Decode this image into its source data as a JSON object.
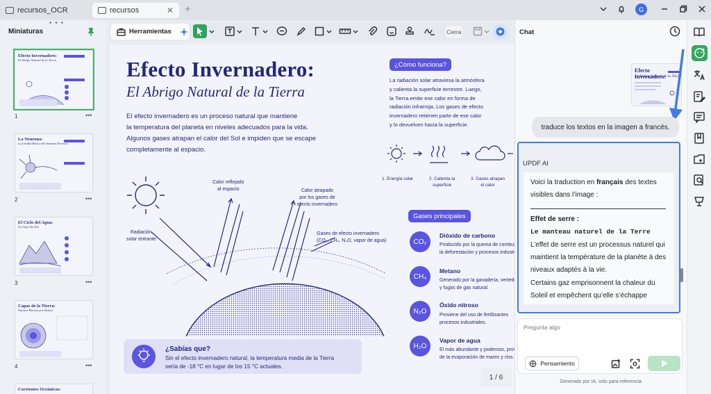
{
  "tabs": [
    {
      "label": "recursos_OCR"
    },
    {
      "label": "recursos"
    }
  ],
  "left_panel": {
    "title": "Miniaturas",
    "pages": [
      {
        "num": "1",
        "t1": "Efecto Invernadero:",
        "t2": "El Abrigo Natural de la Tierra"
      },
      {
        "num": "2",
        "t1": "La Neurona:",
        "t2": "La Unidad Básica del Sistema Nervioso"
      },
      {
        "num": "3",
        "t1": "El Ciclo del Agua:",
        "t2": "Un Viaje Sin Fin"
      },
      {
        "num": "4",
        "t1": "Capas de la Tierra:",
        "t2": "Nuestro Planeta por Dentro"
      },
      {
        "num": "",
        "t1": "Corrientes Oceánicas:",
        "t2": ""
      }
    ]
  },
  "toolbar": {
    "herramientas": "Herramientas",
    "cerrar": "Cerra"
  },
  "document": {
    "title": "Efecto Invernadero:",
    "subtitle": "El Abrigo Natural de la Tierra",
    "intro_lines": [
      "El efecto invernadero es un proceso natural que mantiene",
      "la temperatura del planeta en niveles adecuados para la vida.",
      "Algunos gases atrapan el calor del Sol e impiden que se escape",
      "completamente al espacio."
    ],
    "labels": {
      "radiacion": [
        "Radiación",
        "solar entrante"
      ],
      "reflejado": [
        "Calor reflejado",
        "al espacio"
      ],
      "atrapado": [
        "Calor atrapado",
        "por los gases de",
        "efecto invernadero"
      ],
      "gases": [
        "Gases de efecto invernadero",
        "(CO₂, CH₄, N₂O, vapor de agua)"
      ]
    },
    "como": {
      "title": "¿Cómo funciona?",
      "lines": [
        "La radiación solar atraviesa la atmósfera",
        "y calienta la superficie terrestre. Luego,",
        "la Tierra emite ese calor en forma de",
        "radiación infrarroja. Los gases de efecto",
        "invernadero retienen parte de ese calor",
        "y lo devuelven hacia la superficie."
      ]
    },
    "steps": [
      {
        "a": "1. Energía solar",
        "b": ""
      },
      {
        "a": "2. Calienta la",
        "b": "superficie"
      },
      {
        "a": "3. Gases atrapan",
        "b": "el calor"
      }
    ],
    "gases_title": "Gases principales",
    "gases": [
      {
        "formula": "CO₂",
        "name": "Dióxido de carbono",
        "d1": "Producido por la quema de combustibles",
        "d2": "la deforestación y procesos industriales."
      },
      {
        "formula": "CH₄",
        "name": "Metano",
        "d1": "Generado por la ganadería, vertederos",
        "d2": "y fugas de gas natural."
      },
      {
        "formula": "N₂O",
        "name": "Óxido nitroso",
        "d1": "Proviene del uso de fertilizantes",
        "d2": "procesos industriales."
      },
      {
        "formula": "H₂O",
        "name": "Vapor de agua",
        "d1": "El más abundante y poderoso, proviene",
        "d2": "de la evaporación de mares y ríos."
      }
    ],
    "sabias": {
      "title": "¿Sabías que?",
      "lines": [
        "Sin el efecto invernadero natural, la temperatura media de la Tierra",
        "sería de -18 °C en lugar de los 15 °C actuales."
      ]
    },
    "pager": "1 / 6"
  },
  "chat": {
    "title": "Chat",
    "user_message": "traduce los textos en la imagen a francés.",
    "ai_label": "UPDF AI",
    "ai_intro_pre": "Voici la traduction en ",
    "ai_intro_bold": "français",
    "ai_intro_post": " des textes visibles dans l’image :",
    "ai_h1": "Effet de serre :",
    "ai_h2": "Le manteau naturel de la Terre",
    "ai_p1": "L’effet de serre est un processus naturel qui maintient la température de la planète à des niveaux adaptés à la vie.",
    "ai_p2": "Certains gaz emprisonnent la chaleur du Soleil et empêchent qu’elle s’échappe",
    "input_placeholder": "Pregunta algo",
    "thinking_label": "Pensamiento",
    "disclaimer": "Generado por IA, solo para referencia."
  },
  "user_avatar": "G",
  "colors": {
    "accent_green": "#32a95e",
    "doc_navy": "#23287a",
    "doc_purple": "#5a54e0",
    "highlight_blue": "#3e7be6"
  }
}
